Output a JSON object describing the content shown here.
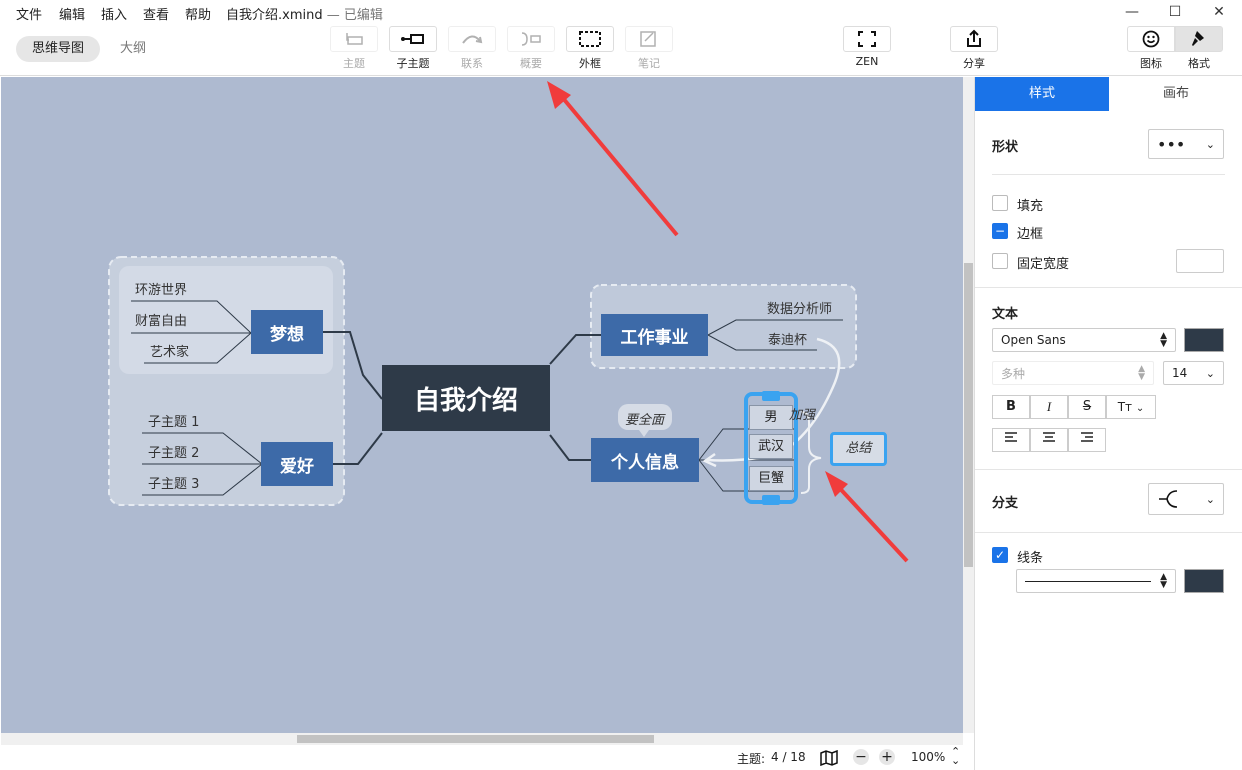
{
  "menu": {
    "file": "文件",
    "edit": "编辑",
    "insert": "插入",
    "view": "查看",
    "help": "帮助"
  },
  "window": {
    "filename": "自我介绍.xmind",
    "status": "— 已编辑"
  },
  "view_tabs": {
    "mindmap": "思维导图",
    "outline": "大纲"
  },
  "toolbar": {
    "topic": "主题",
    "subtopic": "子主题",
    "relation": "联系",
    "summary": "概要",
    "boundary": "外框",
    "note": "笔记",
    "zen": "ZEN",
    "share": "分享",
    "icons": "图标",
    "format": "格式"
  },
  "map": {
    "central": "自我介绍",
    "dream": {
      "label": "梦想",
      "children": [
        "环游世界",
        "财富自由",
        "艺术家"
      ]
    },
    "hobby": {
      "label": "爱好",
      "children": [
        "子主题 1",
        "子主题 2",
        "子主题 3"
      ]
    },
    "career": {
      "label": "工作事业",
      "children": [
        "数据分析师",
        "泰迪杯"
      ]
    },
    "personal": {
      "label": "个人信息",
      "children": [
        "男",
        "武汉",
        "巨蟹"
      ],
      "callout": "要全面"
    },
    "relation_label": "加强",
    "summary": "总结"
  },
  "panel": {
    "tabs": {
      "style": "样式",
      "canvas": "画布"
    },
    "shape": "形状",
    "fill": "填充",
    "border": "边框",
    "fixed_width": "固定宽度",
    "text": "文本",
    "font": "Open Sans",
    "weight": "多种",
    "size": "14",
    "bold": "B",
    "italic": "I",
    "strike": "S",
    "case": "Tт",
    "branch": "分支",
    "line": "线条"
  },
  "status": {
    "topics_label": "主题:",
    "topics_value": "4 / 18",
    "zoom": "100%"
  },
  "colors": {
    "accent": "#1a73e8",
    "canvas": "#aebad0",
    "central": "#2e3a48",
    "topic": "#3d6aa8",
    "selection": "#3aa3f0",
    "arrow": "#f03c3c"
  }
}
